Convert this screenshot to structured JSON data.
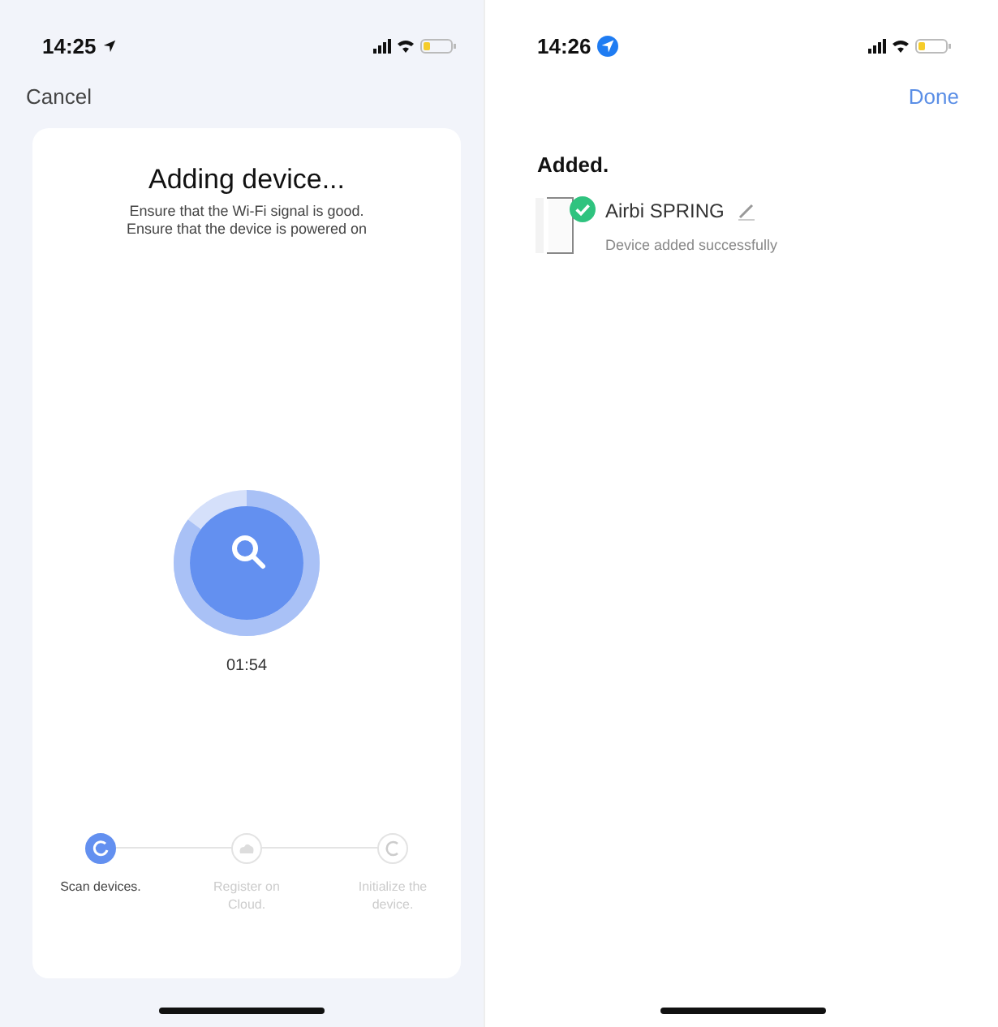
{
  "left_screen": {
    "status_bar": {
      "time": "14:25"
    },
    "cancel": "Cancel",
    "card": {
      "title": "Adding device...",
      "tips": [
        "Ensure that the Wi-Fi signal is good.",
        "Ensure that the device is powered on"
      ],
      "progress": {
        "level": 0.85
      },
      "timer": "01:54",
      "steps": [
        {
          "kind": "scan",
          "label": "Scan devices.",
          "active": true
        },
        {
          "kind": "cloud",
          "label": "Register on Cloud.",
          "active": false
        },
        {
          "kind": "init",
          "label": "Initialize the device.",
          "active": false
        }
      ]
    }
  },
  "right_screen": {
    "status_bar": {
      "time": "14:26"
    },
    "done": "Done",
    "heading": "Added.",
    "device": {
      "name": "Airbi SPRING",
      "status": "Device added successfully",
      "added": true
    }
  }
}
